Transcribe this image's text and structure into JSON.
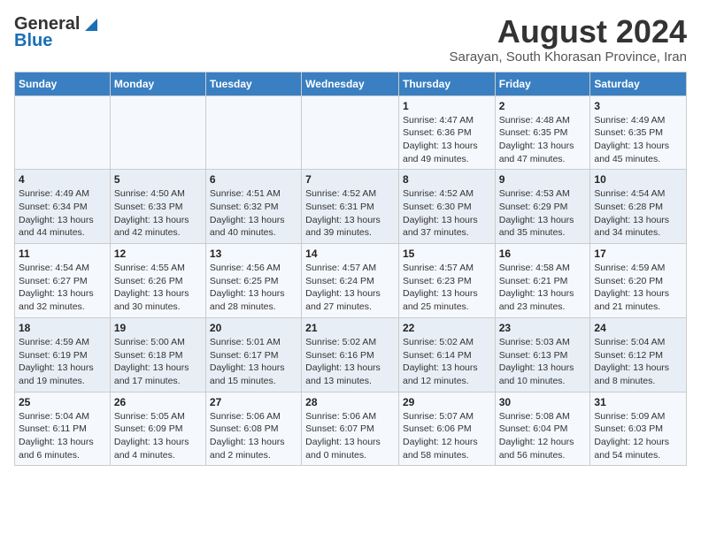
{
  "header": {
    "logo_general": "General",
    "logo_blue": "Blue",
    "title": "August 2024",
    "subtitle": "Sarayan, South Khorasan Province, Iran"
  },
  "weekdays": [
    "Sunday",
    "Monday",
    "Tuesday",
    "Wednesday",
    "Thursday",
    "Friday",
    "Saturday"
  ],
  "weeks": [
    [
      {
        "day": "",
        "detail": ""
      },
      {
        "day": "",
        "detail": ""
      },
      {
        "day": "",
        "detail": ""
      },
      {
        "day": "",
        "detail": ""
      },
      {
        "day": "1",
        "detail": "Sunrise: 4:47 AM\nSunset: 6:36 PM\nDaylight: 13 hours\nand 49 minutes."
      },
      {
        "day": "2",
        "detail": "Sunrise: 4:48 AM\nSunset: 6:35 PM\nDaylight: 13 hours\nand 47 minutes."
      },
      {
        "day": "3",
        "detail": "Sunrise: 4:49 AM\nSunset: 6:35 PM\nDaylight: 13 hours\nand 45 minutes."
      }
    ],
    [
      {
        "day": "4",
        "detail": "Sunrise: 4:49 AM\nSunset: 6:34 PM\nDaylight: 13 hours\nand 44 minutes."
      },
      {
        "day": "5",
        "detail": "Sunrise: 4:50 AM\nSunset: 6:33 PM\nDaylight: 13 hours\nand 42 minutes."
      },
      {
        "day": "6",
        "detail": "Sunrise: 4:51 AM\nSunset: 6:32 PM\nDaylight: 13 hours\nand 40 minutes."
      },
      {
        "day": "7",
        "detail": "Sunrise: 4:52 AM\nSunset: 6:31 PM\nDaylight: 13 hours\nand 39 minutes."
      },
      {
        "day": "8",
        "detail": "Sunrise: 4:52 AM\nSunset: 6:30 PM\nDaylight: 13 hours\nand 37 minutes."
      },
      {
        "day": "9",
        "detail": "Sunrise: 4:53 AM\nSunset: 6:29 PM\nDaylight: 13 hours\nand 35 minutes."
      },
      {
        "day": "10",
        "detail": "Sunrise: 4:54 AM\nSunset: 6:28 PM\nDaylight: 13 hours\nand 34 minutes."
      }
    ],
    [
      {
        "day": "11",
        "detail": "Sunrise: 4:54 AM\nSunset: 6:27 PM\nDaylight: 13 hours\nand 32 minutes."
      },
      {
        "day": "12",
        "detail": "Sunrise: 4:55 AM\nSunset: 6:26 PM\nDaylight: 13 hours\nand 30 minutes."
      },
      {
        "day": "13",
        "detail": "Sunrise: 4:56 AM\nSunset: 6:25 PM\nDaylight: 13 hours\nand 28 minutes."
      },
      {
        "day": "14",
        "detail": "Sunrise: 4:57 AM\nSunset: 6:24 PM\nDaylight: 13 hours\nand 27 minutes."
      },
      {
        "day": "15",
        "detail": "Sunrise: 4:57 AM\nSunset: 6:23 PM\nDaylight: 13 hours\nand 25 minutes."
      },
      {
        "day": "16",
        "detail": "Sunrise: 4:58 AM\nSunset: 6:21 PM\nDaylight: 13 hours\nand 23 minutes."
      },
      {
        "day": "17",
        "detail": "Sunrise: 4:59 AM\nSunset: 6:20 PM\nDaylight: 13 hours\nand 21 minutes."
      }
    ],
    [
      {
        "day": "18",
        "detail": "Sunrise: 4:59 AM\nSunset: 6:19 PM\nDaylight: 13 hours\nand 19 minutes."
      },
      {
        "day": "19",
        "detail": "Sunrise: 5:00 AM\nSunset: 6:18 PM\nDaylight: 13 hours\nand 17 minutes."
      },
      {
        "day": "20",
        "detail": "Sunrise: 5:01 AM\nSunset: 6:17 PM\nDaylight: 13 hours\nand 15 minutes."
      },
      {
        "day": "21",
        "detail": "Sunrise: 5:02 AM\nSunset: 6:16 PM\nDaylight: 13 hours\nand 13 minutes."
      },
      {
        "day": "22",
        "detail": "Sunrise: 5:02 AM\nSunset: 6:14 PM\nDaylight: 13 hours\nand 12 minutes."
      },
      {
        "day": "23",
        "detail": "Sunrise: 5:03 AM\nSunset: 6:13 PM\nDaylight: 13 hours\nand 10 minutes."
      },
      {
        "day": "24",
        "detail": "Sunrise: 5:04 AM\nSunset: 6:12 PM\nDaylight: 13 hours\nand 8 minutes."
      }
    ],
    [
      {
        "day": "25",
        "detail": "Sunrise: 5:04 AM\nSunset: 6:11 PM\nDaylight: 13 hours\nand 6 minutes."
      },
      {
        "day": "26",
        "detail": "Sunrise: 5:05 AM\nSunset: 6:09 PM\nDaylight: 13 hours\nand 4 minutes."
      },
      {
        "day": "27",
        "detail": "Sunrise: 5:06 AM\nSunset: 6:08 PM\nDaylight: 13 hours\nand 2 minutes."
      },
      {
        "day": "28",
        "detail": "Sunrise: 5:06 AM\nSunset: 6:07 PM\nDaylight: 13 hours\nand 0 minutes."
      },
      {
        "day": "29",
        "detail": "Sunrise: 5:07 AM\nSunset: 6:06 PM\nDaylight: 12 hours\nand 58 minutes."
      },
      {
        "day": "30",
        "detail": "Sunrise: 5:08 AM\nSunset: 6:04 PM\nDaylight: 12 hours\nand 56 minutes."
      },
      {
        "day": "31",
        "detail": "Sunrise: 5:09 AM\nSunset: 6:03 PM\nDaylight: 12 hours\nand 54 minutes."
      }
    ]
  ]
}
